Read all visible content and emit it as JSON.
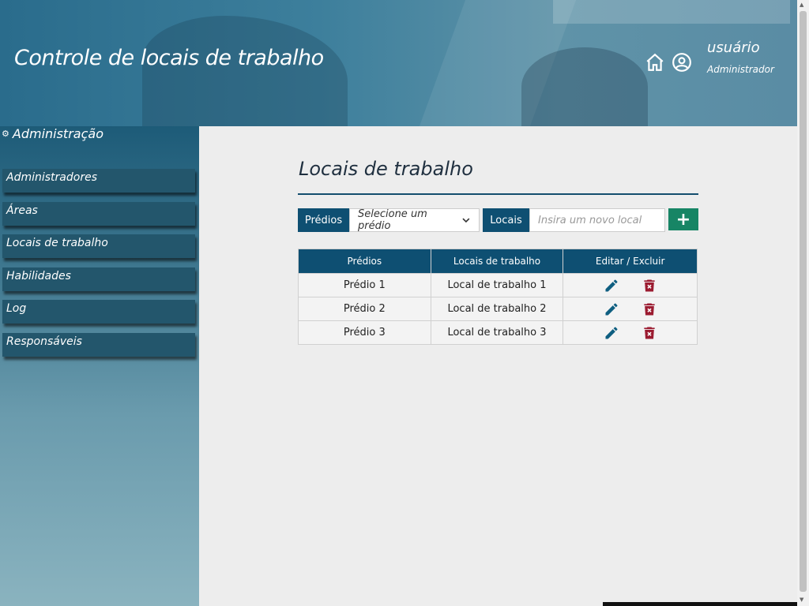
{
  "header": {
    "app_title": "Controle de locais de trabalho",
    "user_name": "usuário",
    "user_role": "Administrador"
  },
  "sidebar": {
    "title": "Administração",
    "items": [
      {
        "label": "Administradores"
      },
      {
        "label": "Áreas"
      },
      {
        "label": "Locais de trabalho"
      },
      {
        "label": "Habilidades"
      },
      {
        "label": "Log"
      },
      {
        "label": "Responsáveis"
      }
    ]
  },
  "main": {
    "title": "Locais de trabalho",
    "form": {
      "predios_label": "Prédios",
      "predio_select_value": "Selecione um prédio",
      "locais_label": "Locais",
      "local_placeholder": "Insira um novo local",
      "add_label": "+"
    },
    "table": {
      "headers": [
        "Prédios",
        "Locais de trabalho",
        "Editar / Excluir"
      ],
      "rows": [
        {
          "predio": "Prédio 1",
          "local": "Local de trabalho 1"
        },
        {
          "predio": "Prédio 2",
          "local": "Local de trabalho 2"
        },
        {
          "predio": "Prédio 3",
          "local": "Local de trabalho 3"
        }
      ]
    }
  },
  "colors": {
    "primary": "#0e4f72",
    "add_button": "#178565",
    "delete_icon": "#9b1b30",
    "edit_icon": "#0e5e80"
  },
  "icons": [
    "home-icon",
    "user-circle-icon",
    "gear-icon",
    "chevron-down-icon",
    "pencil-icon",
    "trash-icon"
  ]
}
